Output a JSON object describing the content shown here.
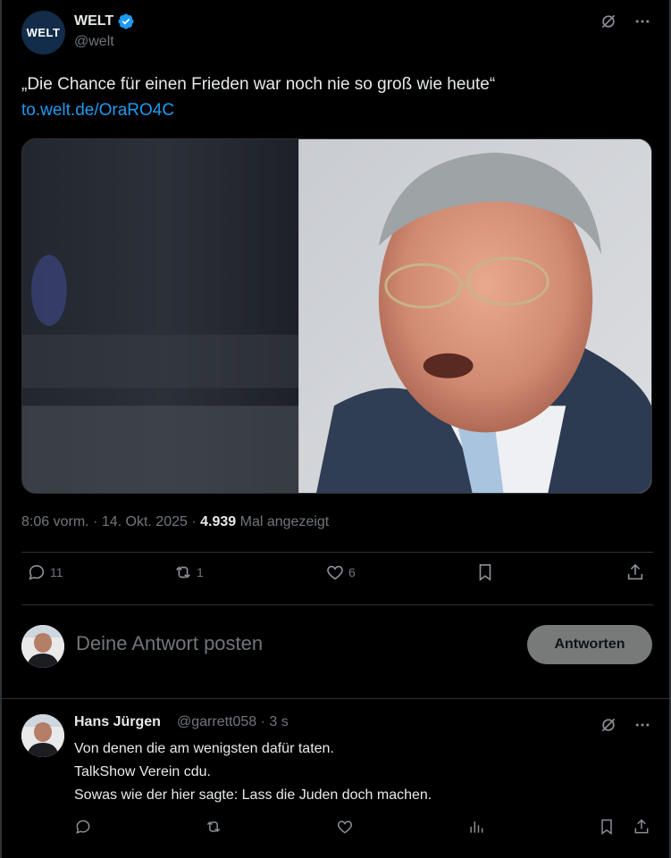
{
  "tweet": {
    "author_name": "WELT",
    "author_handle": "@welt",
    "avatar_text": "WELT",
    "text": "„Die Chance für einen Frieden war noch nie so groß wie heute“",
    "link": "to.welt.de/OraRO4C",
    "time": "8:06 vorm.",
    "date": "14. Okt. 2025",
    "separator": "·",
    "views": "4.939",
    "views_label": "Mal angezeigt",
    "stats": {
      "replies": "11",
      "retweets": "1",
      "likes": "6"
    }
  },
  "composer": {
    "placeholder": "Deine Antwort posten",
    "button": "Antworten"
  },
  "reply": {
    "name": "Hans Jürgen",
    "handle": "@garrett058 · 3 s",
    "lines": [
      "Von denen die am wenigsten dafür taten.",
      "TalkShow Verein cdu.",
      "Sowas wie der hier sagte: Lass die Juden doch machen."
    ]
  },
  "colors": {
    "background": "#000000",
    "text": "#e7e9ea",
    "muted": "#71767b",
    "link": "#1d9bf0",
    "verified": "#1d9bf0",
    "button": "#787a7a"
  },
  "icons": {
    "grok": "grok-icon",
    "more": "more-icon",
    "reply": "reply-icon",
    "retweet": "retweet-icon",
    "like": "like-icon",
    "bookmark": "bookmark-icon",
    "share": "share-icon",
    "views": "views-icon"
  }
}
